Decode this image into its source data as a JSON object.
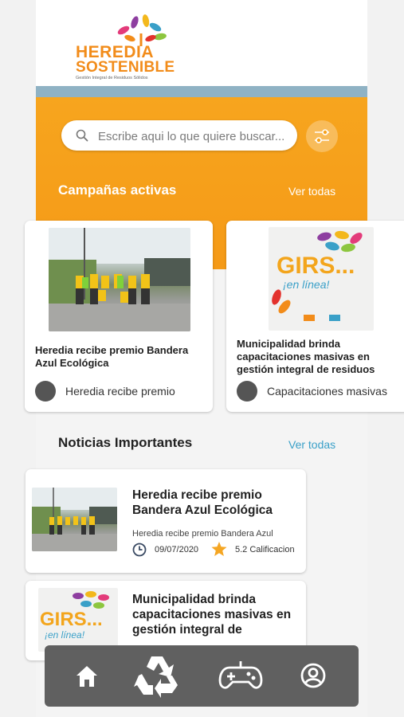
{
  "logo": {
    "line1": "HEREDIA",
    "line2": "SOSTENIBLE",
    "tagline": "Gestión Integral de Residuos Sólidos"
  },
  "search": {
    "placeholder": "Escribe aqui lo que quiere buscar..."
  },
  "campaigns": {
    "title": "Campañas activas",
    "see_all": "Ver todas",
    "items": [
      {
        "title": "Heredia recibe premio Bandera Azul Ecológica",
        "footer": "Heredia recibe premio"
      },
      {
        "title": "Municipalidad brinda capacitaciones masivas en gestión integral de residuos",
        "footer": "Capacitaciones masivas"
      }
    ]
  },
  "news": {
    "title": "Noticias Importantes",
    "see_all": "Ver todas",
    "items": [
      {
        "title": "Heredia recibe premio Bandera Azul Ecológica",
        "subtitle": "Heredia recibe premio Bandera Azul",
        "date": "09/07/2020",
        "rating": "5.2 Calificacion"
      },
      {
        "title": "Municipalidad brinda capacitaciones masivas en gestión integral de"
      }
    ]
  },
  "girs": {
    "line1": "GIRS...",
    "line2": "¡en línea!"
  },
  "colors": {
    "orange": "#f7a51e",
    "blue_strip": "#8fb2c4",
    "link": "#3aa0c8",
    "navbar": "#606060"
  },
  "nav": {
    "items": [
      "home-icon",
      "recycle-icon",
      "gamepad-icon",
      "profile-icon"
    ]
  }
}
